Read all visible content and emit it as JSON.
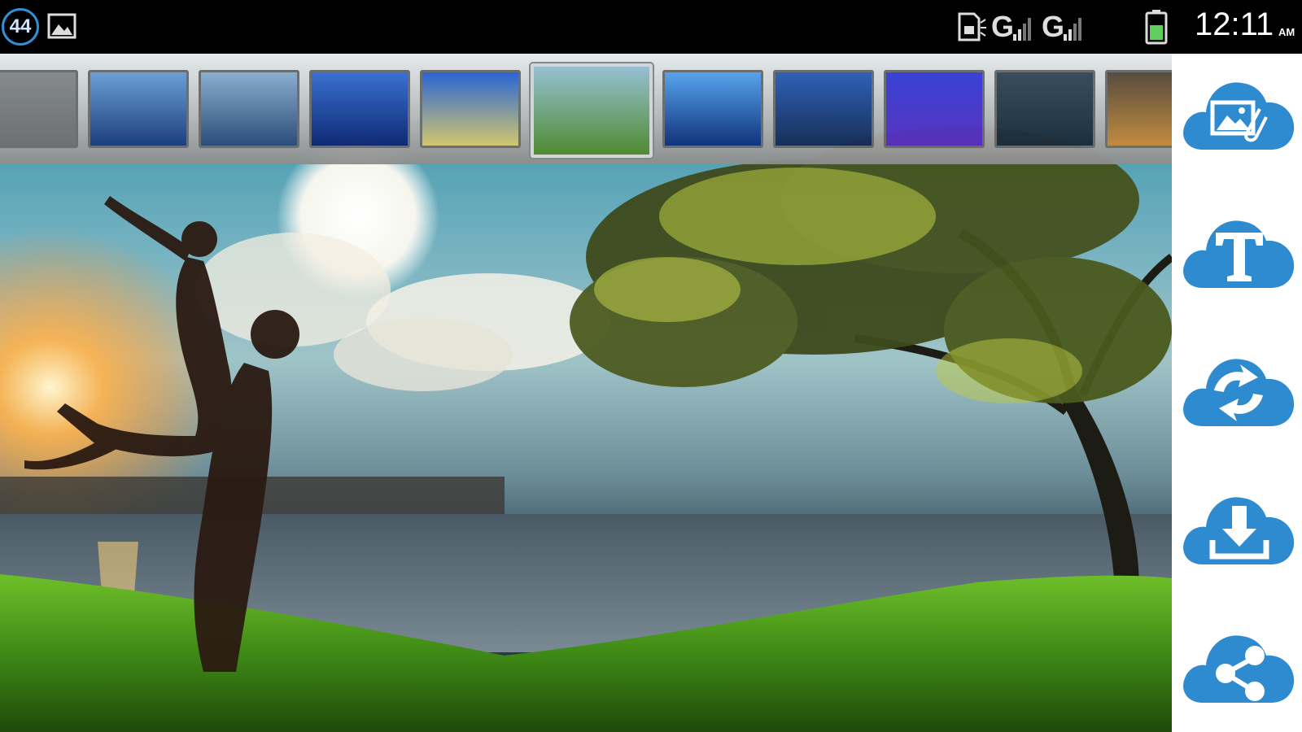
{
  "status_bar": {
    "notification_count": "44",
    "network_1": "G",
    "network_2": "G",
    "time": "12:11",
    "ampm": "AM"
  },
  "filters": {
    "selected_index": 5,
    "items": [
      {
        "name": "plain-gray",
        "colors": [
          "#8a8a8a",
          "#6f6f6f"
        ]
      },
      {
        "name": "moon-sky",
        "colors": [
          "#6fa0d8",
          "#1b3a7a"
        ]
      },
      {
        "name": "moon-sea",
        "colors": [
          "#8fb0d0",
          "#2a4a78"
        ]
      },
      {
        "name": "blue-night",
        "colors": [
          "#3b6fd6",
          "#0c2470"
        ]
      },
      {
        "name": "blue-beach",
        "colors": [
          "#2a63d8",
          "#d9c96a"
        ]
      },
      {
        "name": "tree-lake",
        "colors": [
          "#9cc3d6",
          "#4f8a2a"
        ]
      },
      {
        "name": "blue-burst",
        "colors": [
          "#5aa4f0",
          "#0d2f7a"
        ]
      },
      {
        "name": "night-lake",
        "colors": [
          "#2f5fb8",
          "#152a55"
        ]
      },
      {
        "name": "dolphin-moon",
        "colors": [
          "#3a3ed8",
          "#5a2fc0"
        ]
      },
      {
        "name": "dark-shore",
        "colors": [
          "#3a4a5a",
          "#1a2a3a"
        ]
      },
      {
        "name": "sunset-harbor",
        "colors": [
          "#5a4a3a",
          "#c88a3a"
        ]
      }
    ]
  },
  "toolbar": {
    "accent": "#2f8bd0",
    "buttons": [
      {
        "name": "add-photo",
        "icon": "image-attach-icon"
      },
      {
        "name": "add-text",
        "icon": "text-icon"
      },
      {
        "name": "flip",
        "icon": "refresh-arrows-icon"
      },
      {
        "name": "save",
        "icon": "download-icon"
      },
      {
        "name": "share",
        "icon": "share-icon"
      }
    ]
  }
}
